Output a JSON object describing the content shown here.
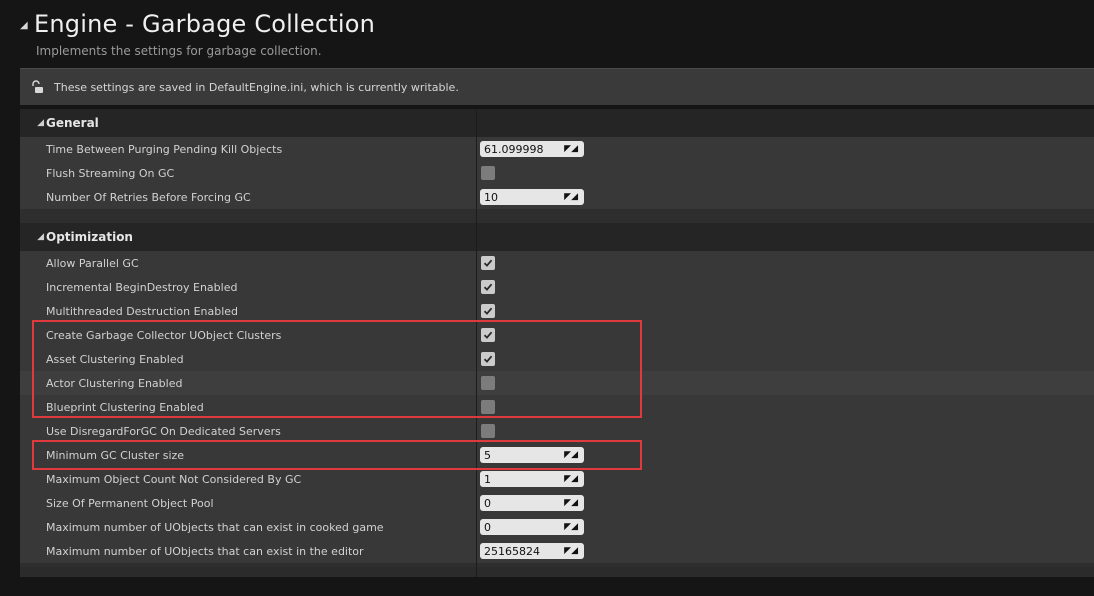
{
  "header": {
    "title": "Engine - Garbage Collection",
    "subtitle": "Implements the settings for garbage collection."
  },
  "notice": {
    "icon": "unlock-icon",
    "text": "These settings are saved in DefaultEngine.ini, which is currently writable."
  },
  "sections": {
    "general": {
      "label": "General",
      "rows": [
        {
          "label": "Time Between Purging Pending Kill Objects",
          "type": "number",
          "value": "61.099998"
        },
        {
          "label": "Flush Streaming On GC",
          "type": "checkbox",
          "checked": false
        },
        {
          "label": "Number Of Retries Before Forcing GC",
          "type": "number",
          "value": "10"
        }
      ]
    },
    "optimization": {
      "label": "Optimization",
      "rows": [
        {
          "label": "Allow Parallel GC",
          "type": "checkbox",
          "checked": true
        },
        {
          "label": "Incremental BeginDestroy Enabled",
          "type": "checkbox",
          "checked": true
        },
        {
          "label": "Multithreaded Destruction Enabled",
          "type": "checkbox",
          "checked": true
        },
        {
          "label": "Create Garbage Collector UObject Clusters",
          "type": "checkbox",
          "checked": true
        },
        {
          "label": "Asset Clustering Enabled",
          "type": "checkbox",
          "checked": true
        },
        {
          "label": "Actor Clustering Enabled",
          "type": "checkbox",
          "checked": false
        },
        {
          "label": "Blueprint Clustering Enabled",
          "type": "checkbox",
          "checked": false
        },
        {
          "label": "Use DisregardForGC On Dedicated Servers",
          "type": "checkbox",
          "checked": false
        },
        {
          "label": "Minimum GC Cluster size",
          "type": "number",
          "value": "5"
        },
        {
          "label": "Maximum Object Count Not Considered By GC",
          "type": "number",
          "value": "1"
        },
        {
          "label": "Size Of Permanent Object Pool",
          "type": "number",
          "value": "0"
        },
        {
          "label": "Maximum number of UObjects that can exist in cooked game",
          "type": "number",
          "value": "0"
        },
        {
          "label": "Maximum number of UObjects that can exist in the editor",
          "type": "number",
          "value": "25165824"
        }
      ]
    }
  },
  "colors": {
    "highlight": "#e0393e",
    "row": "#383838",
    "section_header": "#252525"
  }
}
